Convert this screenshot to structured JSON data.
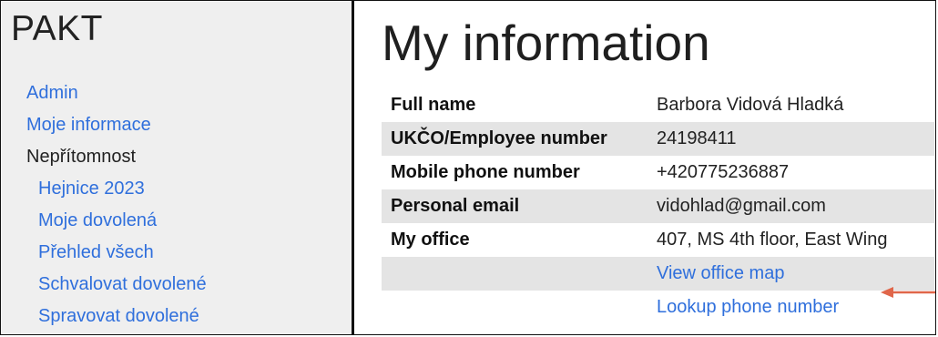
{
  "app": {
    "logo": "PAKT"
  },
  "sidebar": {
    "items": [
      {
        "label": "Admin",
        "link": true,
        "indent": false
      },
      {
        "label": "Moje informace",
        "link": true,
        "indent": false
      },
      {
        "label": "Nepřítomnost",
        "link": false,
        "indent": false
      },
      {
        "label": "Hejnice 2023",
        "link": true,
        "indent": true
      },
      {
        "label": "Moje dovolená",
        "link": true,
        "indent": true
      },
      {
        "label": "Přehled všech",
        "link": true,
        "indent": true
      },
      {
        "label": "Schvalovat dovolené",
        "link": true,
        "indent": true
      },
      {
        "label": "Spravovat dovolené",
        "link": true,
        "indent": true
      }
    ]
  },
  "main": {
    "title": "My information",
    "rows": [
      {
        "key": "Full name",
        "value": "Barbora Vidová Hladká"
      },
      {
        "key": "UKČO/Employee number",
        "value": "24198411"
      },
      {
        "key": "Mobile phone number",
        "value": "+420775236887"
      },
      {
        "key": "Personal email",
        "value": "vidohlad@gmail.com"
      },
      {
        "key": "My office",
        "value": "407, MS 4th floor, East Wing"
      }
    ],
    "links": {
      "office_map": "View office map",
      "lookup_phone": "Lookup phone number"
    }
  },
  "colors": {
    "link": "#2f6fdc",
    "shade": "#e4e4e4",
    "sidebar_bg": "#efefef",
    "arrow": "#e0664a"
  },
  "annotation": {
    "icon": "arrow-left-icon"
  }
}
